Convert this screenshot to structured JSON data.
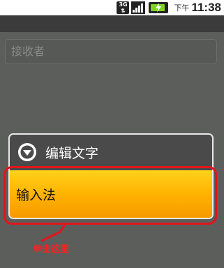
{
  "status_bar": {
    "network_label": "3G",
    "ampm": "下午",
    "time": "11:38",
    "icons": [
      "3g-icon",
      "signal-icon",
      "battery-icon"
    ]
  },
  "compose": {
    "recipient_placeholder": "接收者"
  },
  "popup_menu": {
    "header_label": "编辑文字",
    "header_icon": "chevron-down-circle-icon",
    "items": [
      {
        "label": "输入法",
        "highlighted": true
      }
    ]
  },
  "annotation": {
    "text": "单击这里",
    "color": "#e4141b"
  },
  "colors": {
    "background": "#5c5e5c",
    "highlight": "#ffb000",
    "popup_border": "#e8e8e8"
  }
}
